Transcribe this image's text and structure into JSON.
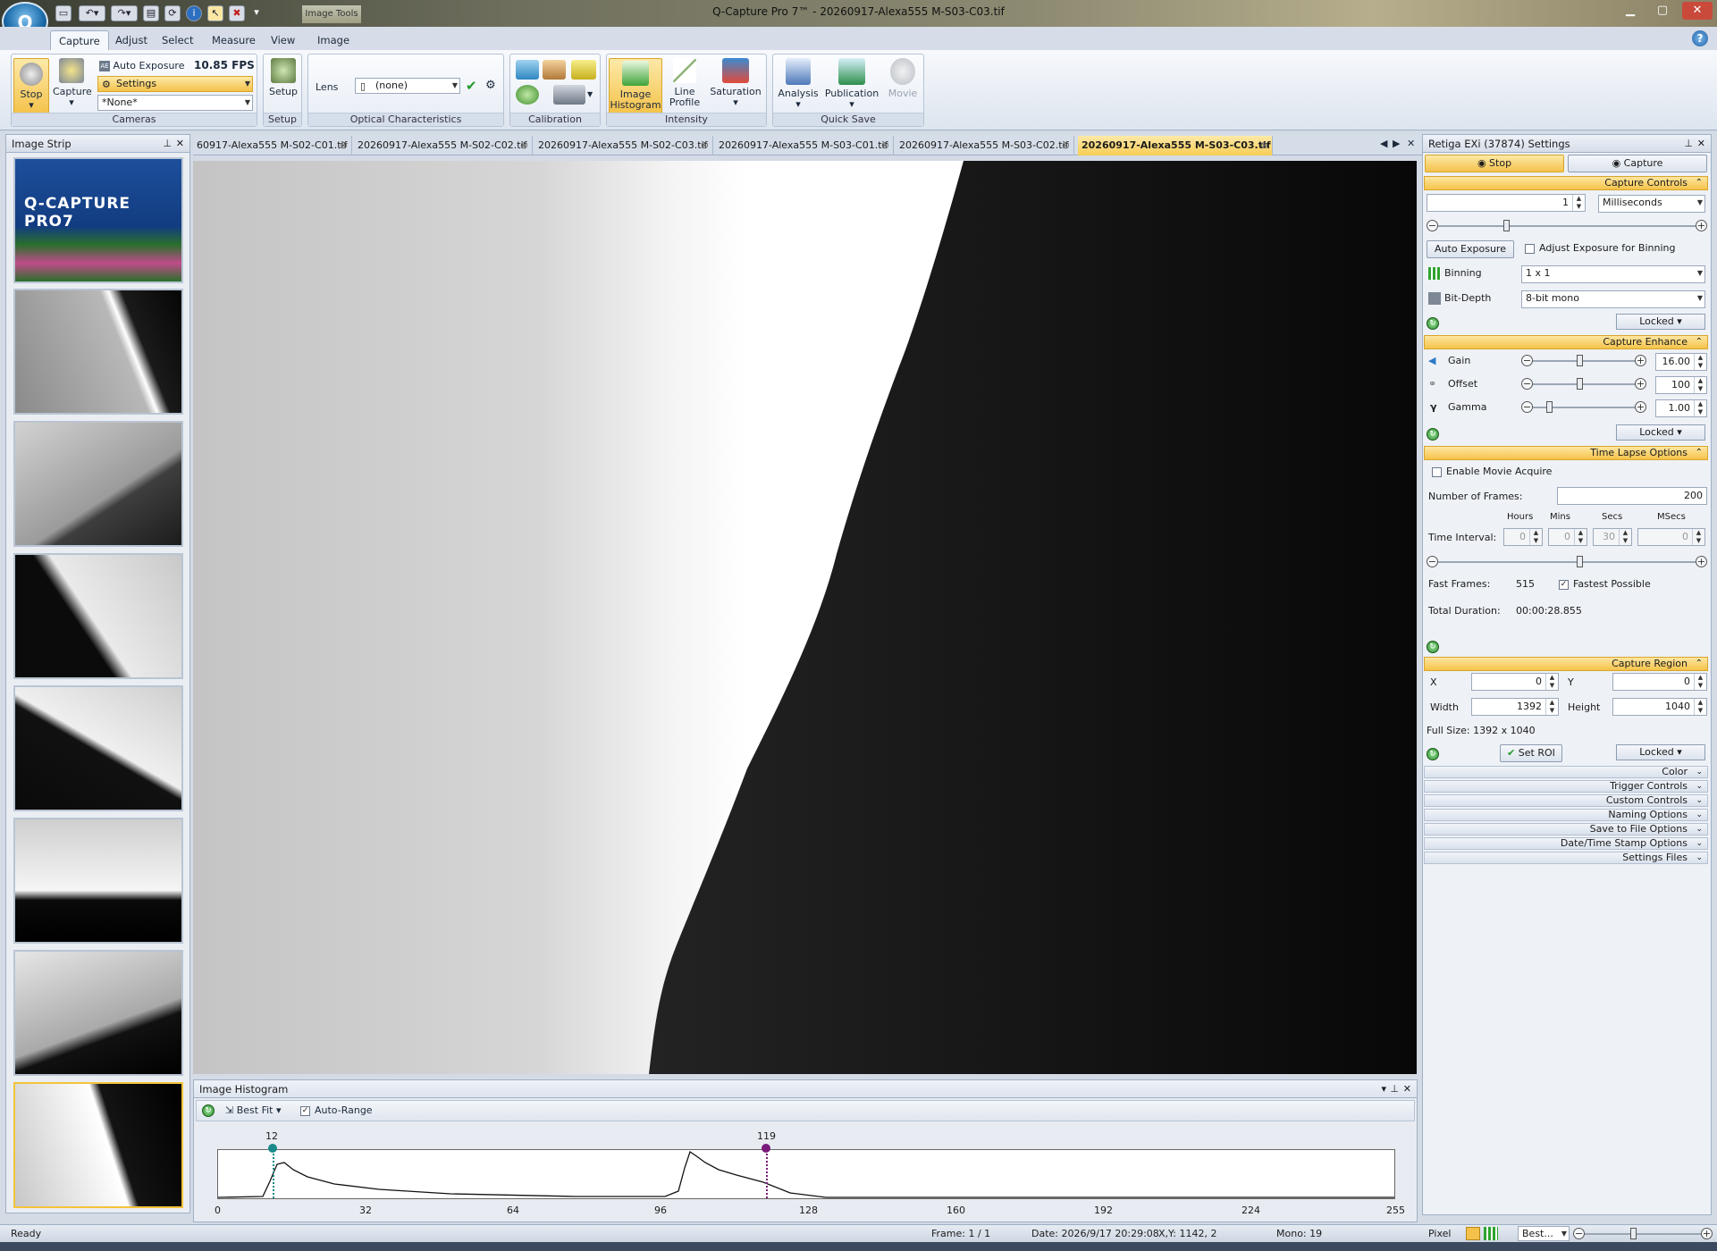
{
  "window": {
    "title": "Q-Capture Pro 7™ - 20260917-Alexa555 M-S03-C03.tif",
    "context_tab": "Image Tools",
    "app_button": "Q"
  },
  "ribbon_tabs": [
    "Capture",
    "Adjust",
    "Select",
    "Measure",
    "View",
    "Image"
  ],
  "cameras": {
    "stop": "Stop",
    "capture": "Capture",
    "auto_exposure": "Auto Exposure",
    "fps": "10.85 FPS",
    "settings": "Settings",
    "preset": "*None*",
    "label": "Cameras"
  },
  "setup": {
    "button": "Setup",
    "label": "Setup"
  },
  "optical": {
    "lens_label": "Lens",
    "lens_value": "(none)",
    "label": "Optical Characteristics"
  },
  "calibration": {
    "label": "Calibration"
  },
  "intensity": {
    "histogram": "Image Histogram",
    "line_profile": "Line Profile",
    "saturation": "Saturation",
    "label": "Intensity"
  },
  "quick_save": {
    "analysis": "Analysis",
    "publication": "Publication",
    "movie": "Movie",
    "label": "Quick Save"
  },
  "image_strip": {
    "title": "Image Strip",
    "logo_text": "Q-CAPTURE PRO7"
  },
  "doc_tabs": [
    "60917-Alexa555 M-S02-C01.tif",
    "20260917-Alexa555 M-S02-C02.tif",
    "20260917-Alexa555 M-S02-C03.tif",
    "20260917-Alexa555 M-S03-C01.tif",
    "20260917-Alexa555 M-S03-C02.tif",
    "20260917-Alexa555 M-S03-C03.tif"
  ],
  "histogram": {
    "title": "Image Histogram",
    "fit": "Best Fit",
    "auto_range": "Auto-Range",
    "low_marker": "12",
    "high_marker": "119",
    "axis_ticks": [
      "0",
      "32",
      "64",
      "96",
      "128",
      "160",
      "192",
      "224",
      "255"
    ]
  },
  "settings": {
    "title": "Retiga EXi (37874) Settings",
    "stop": "Stop",
    "capture": "Capture",
    "capture_controls": "Capture Controls",
    "exposure_value": "1",
    "exposure_unit": "Milliseconds",
    "auto_exposure": "Auto Exposure",
    "adjust_binning": "Adjust Exposure for Binning",
    "binning_label": "Binning",
    "binning_value": "1 x 1",
    "bitdepth_label": "Bit-Depth",
    "bitdepth_value": "8-bit mono",
    "locked": "Locked",
    "capture_enhance": "Capture Enhance",
    "gain_label": "Gain",
    "gain_value": "16.00",
    "offset_label": "Offset",
    "offset_value": "100",
    "gamma_label": "Gamma",
    "gamma_value": "1.00",
    "time_lapse": "Time Lapse Options",
    "enable_movie": "Enable Movie Acquire",
    "frames_label": "Number of Frames:",
    "frames_value": "200",
    "hours": "Hours",
    "mins": "Mins",
    "secs": "Secs",
    "msecs": "MSecs",
    "interval_label": "Time Interval:",
    "interval_h": "0",
    "interval_m": "0",
    "interval_s": "30",
    "interval_ms": "0",
    "fast_frames_label": "Fast Frames:",
    "fast_frames_value": "515",
    "fastest_possible": "Fastest Possible",
    "total_duration_label": "Total Duration:",
    "total_duration_value": "00:00:28.855",
    "capture_region": "Capture Region",
    "x_label": "X",
    "x_value": "0",
    "y_label": "Y",
    "y_value": "0",
    "width_label": "Width",
    "width_value": "1392",
    "height_label": "Height",
    "height_value": "1040",
    "full_size": "Full Size: 1392 x 1040",
    "set_roi": "Set ROI",
    "collapsed": [
      "Color",
      "Trigger Controls",
      "Custom Controls",
      "Naming Options",
      "Save to File Options",
      "Date/Time Stamp Options",
      "Settings Files"
    ]
  },
  "status": {
    "ready": "Ready",
    "frame": "Frame: 1 / 1",
    "date": "Date: 2026/9/17 20:29:08",
    "xy": "X,Y: 1142,    2",
    "mono": "Mono:    19",
    "pixel": "Pixel",
    "zoom": "Best..."
  }
}
